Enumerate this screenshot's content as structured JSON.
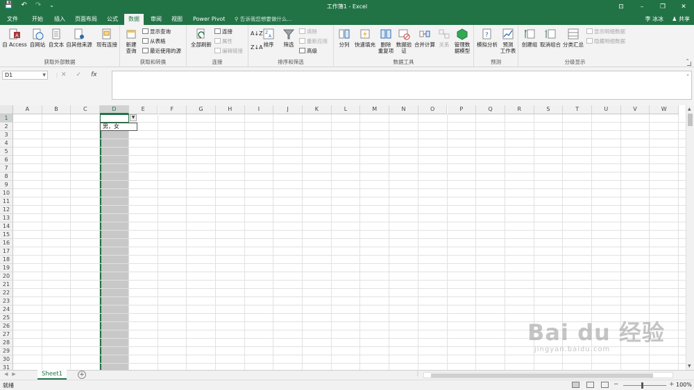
{
  "title_bar": {
    "title": "工作簿1 - Excel",
    "window_controls": [
      "⊡",
      "–",
      "❐",
      "✕"
    ]
  },
  "tabs": [
    "文件",
    "开始",
    "插入",
    "页面布局",
    "公式",
    "数据",
    "审阅",
    "视图",
    "Power Pivot"
  ],
  "active_tab": "数据",
  "tell_me": "告诉我您想要做什么...",
  "user": "李 冰冰",
  "share": "共享",
  "ribbon": {
    "groups": {
      "external": "获取外部数据",
      "transform": "获取和转换",
      "connections": "连接",
      "sort_filter": "排序和筛选",
      "data_tools": "数据工具",
      "forecast": "预测",
      "outline": "分级显示"
    },
    "buttons": {
      "from_access": "自 Access",
      "from_web": "自网站",
      "from_text": "自文本",
      "from_other": "自其他来源",
      "existing_conn": "现有连接",
      "new_query_1": "新建",
      "new_query_2": "查询",
      "show_queries": "显示查询",
      "from_table": "从表格",
      "recent_sources": "最近使用的源",
      "refresh_all": "全部刷新",
      "connections": "连接",
      "properties": "属性",
      "edit_links": "编辑链接",
      "sort": "排序",
      "filter": "筛选",
      "clear": "清除",
      "reapply": "重新应用",
      "advanced": "高级",
      "text_to_col": "分列",
      "flash_fill": "快速填充",
      "remove_dup_1": "删除",
      "remove_dup_2": "重复项",
      "validation_1": "数据验",
      "validation_2": "证",
      "consolidate": "合并计算",
      "relationships": "关系",
      "data_model_1": "管理数",
      "data_model_2": "据模型",
      "whatif": "模拟分析",
      "forecast_1": "预测",
      "forecast_2": "工作表",
      "group": "创建组",
      "ungroup": "取消组合",
      "subtotal": "分类汇总",
      "show_detail": "显示明细数据",
      "hide_detail": "隐藏明细数据"
    }
  },
  "formula_bar": {
    "name_box": "D1",
    "cancel": "✕",
    "enter": "✓",
    "fx": "fx",
    "value": ""
  },
  "grid": {
    "columns": [
      "A",
      "B",
      "C",
      "D",
      "E",
      "F",
      "G",
      "H",
      "I",
      "J",
      "K",
      "L",
      "M",
      "N",
      "O",
      "P",
      "Q",
      "R",
      "S",
      "T",
      "U",
      "V",
      "W"
    ],
    "rows": [
      "1",
      "2",
      "3",
      "4",
      "5",
      "6",
      "7",
      "8",
      "9",
      "10",
      "11",
      "12",
      "13",
      "14",
      "15",
      "16",
      "17",
      "18",
      "19",
      "20",
      "21",
      "22",
      "23",
      "24",
      "25",
      "26",
      "27",
      "28",
      "29",
      "30",
      "31"
    ],
    "selected_cell": "D1",
    "dropdown_options": [
      "男，女"
    ]
  },
  "sheet_tabs": [
    "Sheet1"
  ],
  "status": {
    "ready": "就绪",
    "zoom": "100%"
  },
  "watermark": {
    "brand": "Bai du 经验",
    "url": "jingyan.baidu.com"
  }
}
